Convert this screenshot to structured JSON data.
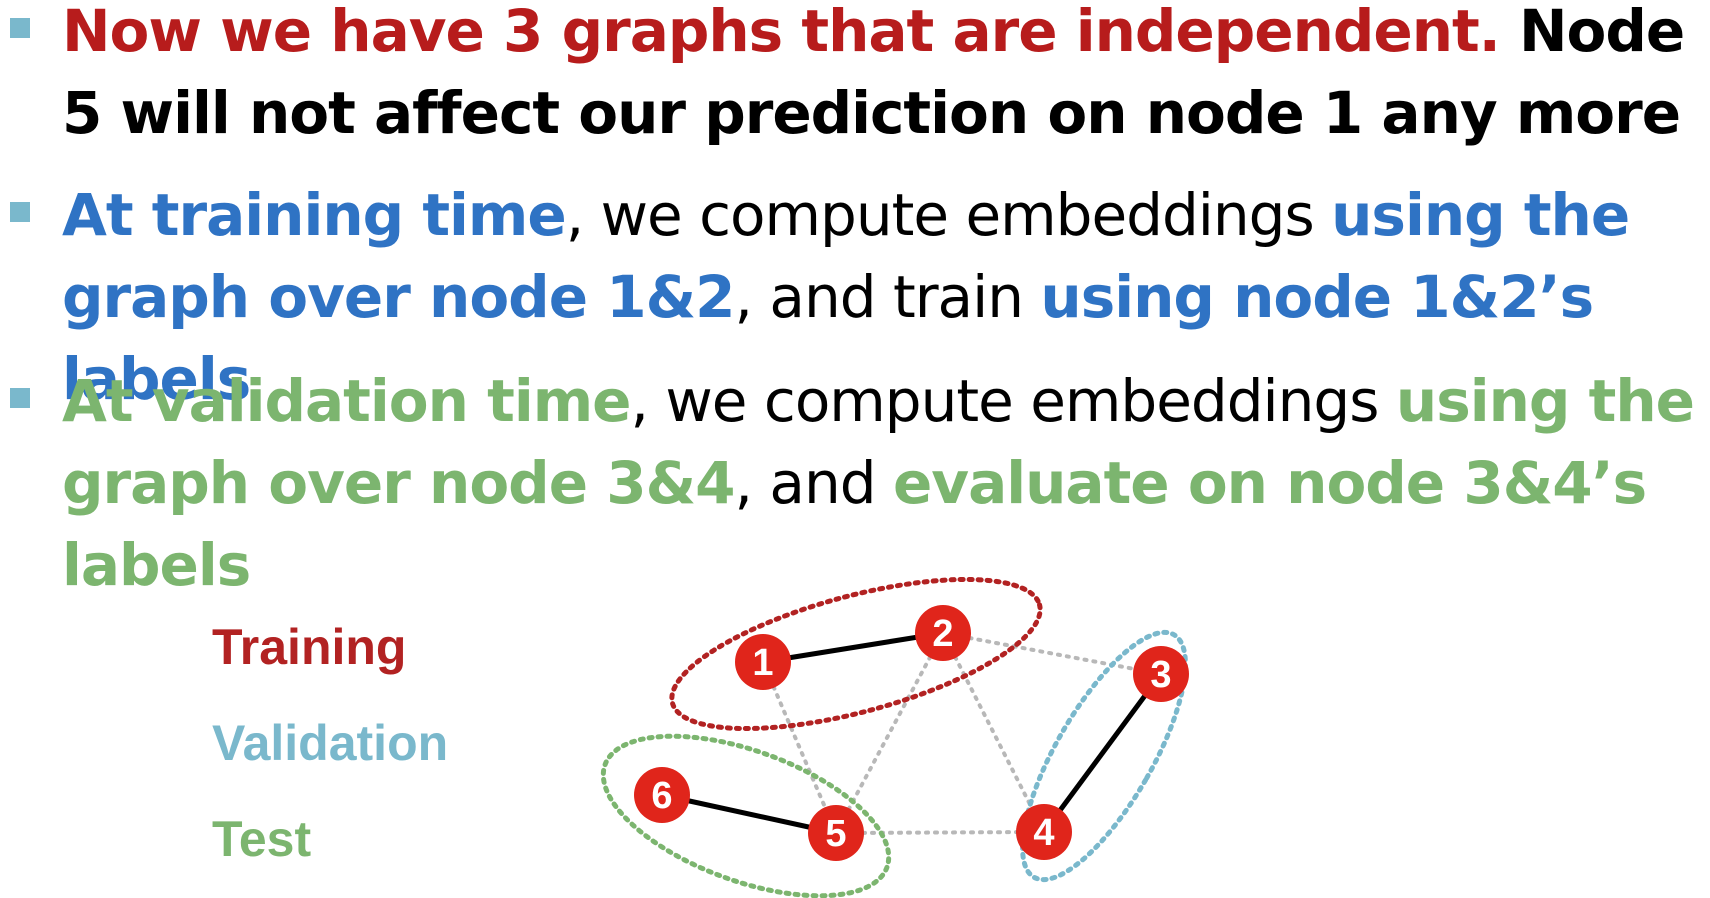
{
  "bullets": [
    {
      "segments": [
        {
          "text": "Now we have 3 graphs that are independent.",
          "cls": "b red"
        },
        {
          "text": " Node 5 will not affect our prediction on node 1 any more",
          "cls": "b blk"
        }
      ]
    },
    {
      "segments": [
        {
          "text": "At training time",
          "cls": "b blue"
        },
        {
          "text": ", we compute embeddings ",
          "cls": "blk"
        },
        {
          "text": "using the graph over node 1&2",
          "cls": "b blue"
        },
        {
          "text": ", and train ",
          "cls": "blk"
        },
        {
          "text": "using node 1&2’s labels",
          "cls": "b blue"
        }
      ]
    },
    {
      "segments": [
        {
          "text": "At validation time",
          "cls": "b green"
        },
        {
          "text": ", we compute embeddings ",
          "cls": "blk"
        },
        {
          "text": "using the graph over node 3&4",
          "cls": "b green"
        },
        {
          "text": ", and ",
          "cls": "blk"
        },
        {
          "text": "evaluate on node 3&4’s labels",
          "cls": "b green"
        }
      ]
    }
  ],
  "legend": {
    "training": "Training",
    "validation": "Validation",
    "test": "Test"
  },
  "graph": {
    "nodes": [
      "1",
      "2",
      "3",
      "4",
      "5",
      "6"
    ],
    "solid_edges": [
      [
        "1",
        "2"
      ],
      [
        "3",
        "4"
      ],
      [
        "6",
        "5"
      ]
    ],
    "dotted_edges": [
      [
        "1",
        "5"
      ],
      [
        "2",
        "5"
      ],
      [
        "2",
        "3"
      ],
      [
        "2",
        "4"
      ],
      [
        "5",
        "4"
      ]
    ],
    "groups": [
      {
        "name": "training",
        "nodes": [
          "1",
          "2"
        ],
        "color": "#b22222"
      },
      {
        "name": "validation",
        "nodes": [
          "3",
          "4"
        ],
        "color": "#7ab8cc"
      },
      {
        "name": "test",
        "nodes": [
          "5",
          "6"
        ],
        "color": "#7cb56f"
      }
    ],
    "node_color": "#e0251b"
  }
}
